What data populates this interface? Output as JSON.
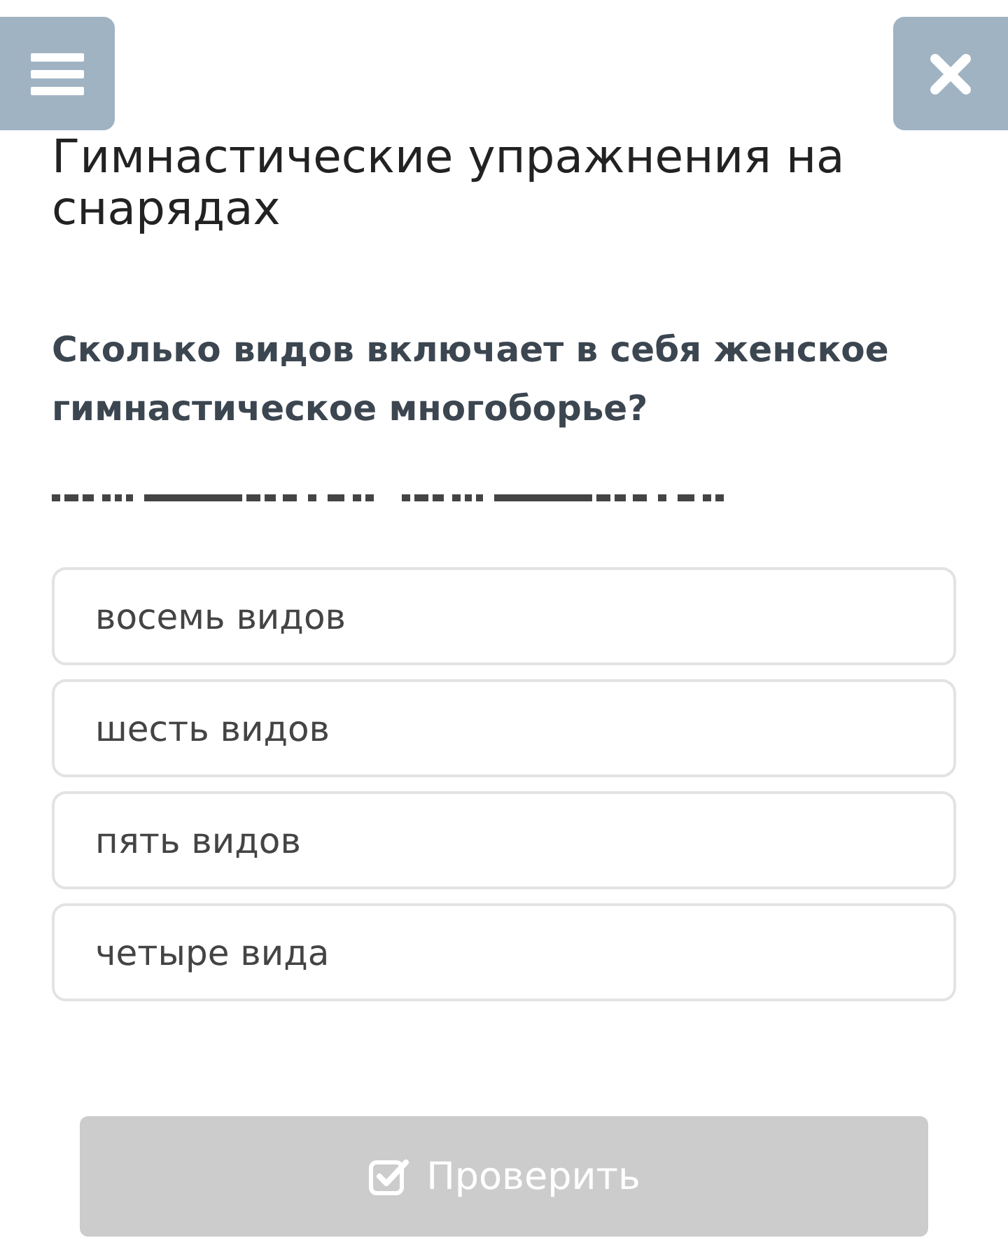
{
  "title": "Гимнастические упражнения на снарядах",
  "question": "Сколько видов включает в себя женское гимнастическое многоборье?",
  "options": [
    {
      "label": "восемь видов",
      "selected": false
    },
    {
      "label": "шесть видов",
      "selected": false
    },
    {
      "label": "пять видов",
      "selected": false
    },
    {
      "label": "четыре вида",
      "selected": false
    }
  ],
  "check_button": {
    "label": "Проверить",
    "disabled": true
  }
}
